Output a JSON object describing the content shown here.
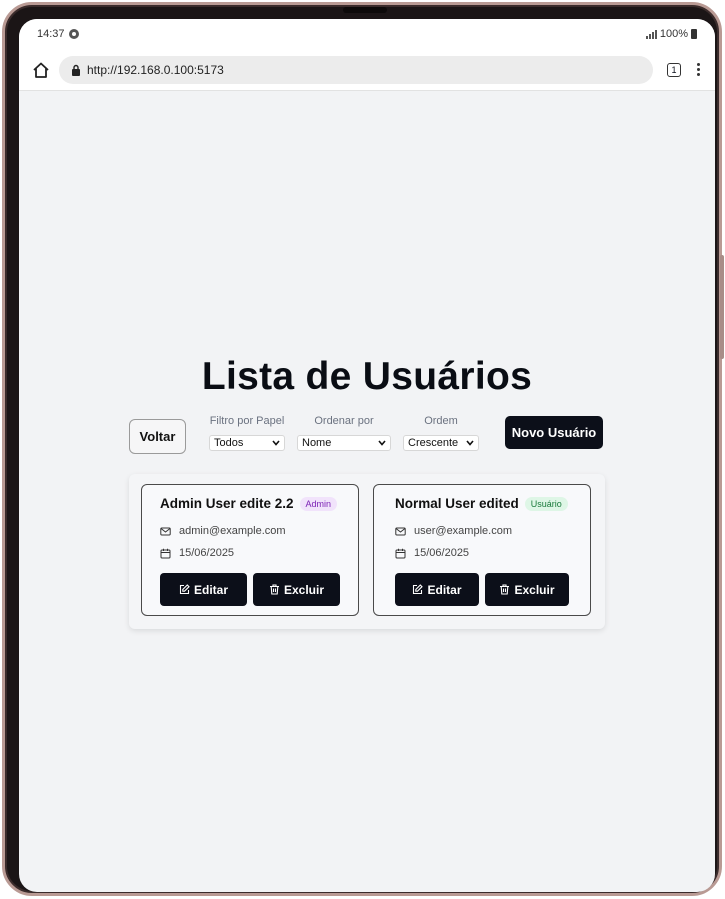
{
  "status_bar": {
    "time": "14:37",
    "battery": "100%"
  },
  "browser": {
    "url": "http://192.168.0.100:5173",
    "tab_count": "1"
  },
  "page": {
    "title": "Lista de Usuários",
    "back_label": "Voltar",
    "new_user_label": "Novo Usuário",
    "filters": {
      "role": {
        "label": "Filtro por Papel",
        "value": "Todos"
      },
      "sort_by": {
        "label": "Ordenar por",
        "value": "Nome"
      },
      "order": {
        "label": "Ordem",
        "value": "Crescente"
      }
    },
    "users": [
      {
        "name": "Admin User edite 2.2",
        "role_badge": "Admin",
        "email": "admin@example.com",
        "date": "15/06/2025",
        "edit_label": "Editar",
        "delete_label": "Excluir"
      },
      {
        "name": "Normal User edited",
        "role_badge": "Usuário",
        "email": "user@example.com",
        "date": "15/06/2025",
        "edit_label": "Editar",
        "delete_label": "Excluir"
      }
    ]
  },
  "colors": {
    "primary_button": "#0c0f19",
    "page_background": "#f2f3f5",
    "admin_badge_bg": "#f1e3fb",
    "admin_badge_text": "#7c22b5",
    "user_badge_bg": "#def6e6",
    "user_badge_text": "#1a7a3c"
  },
  "icons": {
    "home": "home-icon",
    "lock": "lock-icon",
    "tabs": "tabs-icon",
    "menu": "more-vert-icon",
    "email": "mail-icon",
    "date": "calendar-icon",
    "edit": "edit-icon",
    "delete": "trash-icon"
  }
}
